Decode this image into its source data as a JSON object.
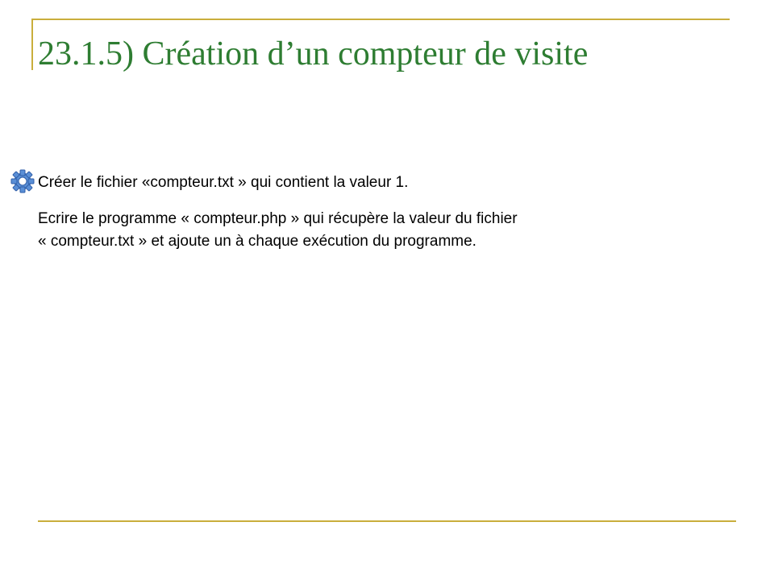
{
  "slide": {
    "title": "23.1.5) Création d’un compteur de visite",
    "bullet_icon": "gear-icon",
    "accent_color": "#c9ae3c",
    "title_color": "#2e7d32",
    "paragraphs": [
      "Créer le fichier «compteur.txt » qui contient la valeur 1.",
      {
        "line1": "Ecrire le programme « compteur.php » qui récupère la valeur du fichier",
        "line2": "« compteur.txt » et ajoute un à chaque exécution du programme."
      }
    ]
  }
}
